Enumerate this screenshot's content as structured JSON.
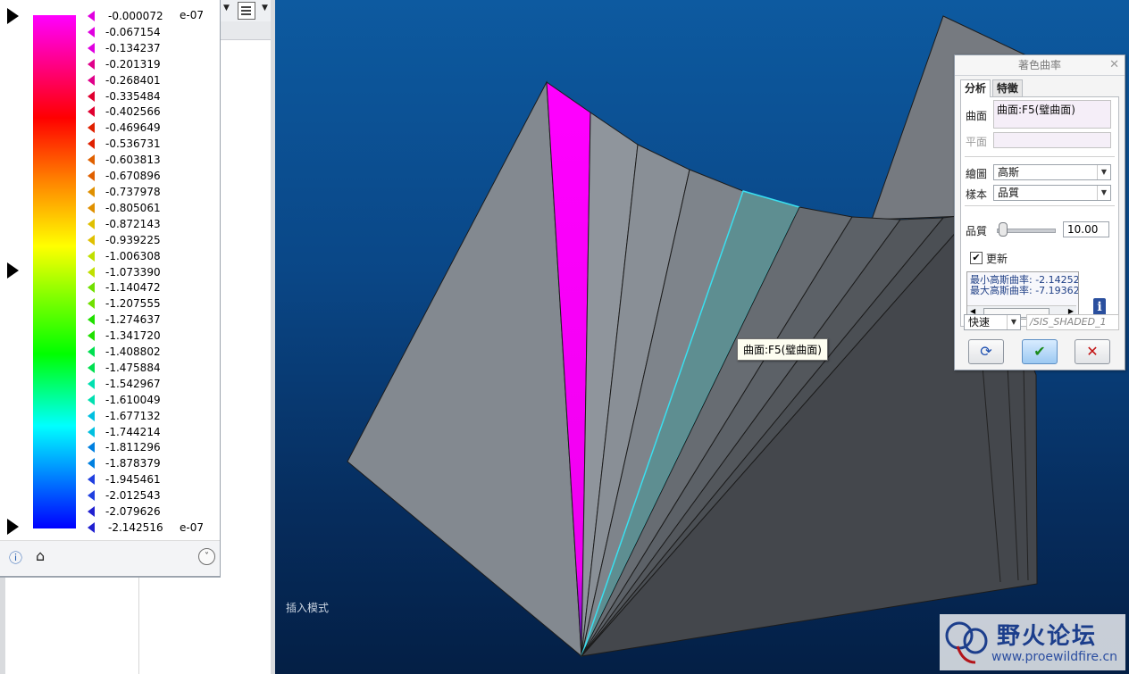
{
  "legend": {
    "values": [
      "-0.000072",
      "-0.067154",
      "-0.134237",
      "-0.201319",
      "-0.268401",
      "-0.335484",
      "-0.402566",
      "-0.469649",
      "-0.536731",
      "-0.603813",
      "-0.670896",
      "-0.737978",
      "-0.805061",
      "-0.872143",
      "-0.939225",
      "-1.006308",
      "-1.073390",
      "-1.140472",
      "-1.207555",
      "-1.274637",
      "-1.341720",
      "-1.408802",
      "-1.475884",
      "-1.542967",
      "-1.610049",
      "-1.677132",
      "-1.744214",
      "-1.811296",
      "-1.878379",
      "-1.945461",
      "-2.012543",
      "-2.079626",
      "-2.142516"
    ],
    "exponent_top": "e-07",
    "exponent_bottom": "e-07",
    "colors": [
      "#ff00ff",
      "#ff0000",
      "#ffff00",
      "#00ff00",
      "#00ffff",
      "#0000ff"
    ]
  },
  "viewport": {
    "mode_label": "插入模式",
    "tooltip": "曲面:F5(璧曲面)"
  },
  "dialog": {
    "title": "著色曲率",
    "tabs": [
      "分析",
      "特徵"
    ],
    "surface_label": "曲面",
    "surface_value": "曲面:F5(璧曲面)",
    "plane_label": "平面",
    "plot_label": "繪圖",
    "plot_value": "高斯",
    "sample_label": "樣本",
    "sample_value": "品質",
    "quality_label": "品質",
    "quality_value": "10.00",
    "update_label": "更新",
    "min_text": "最小高斯曲率: -2.14252",
    "max_text": "最大高斯曲率: -7.19362",
    "speed_value": "快速",
    "name_value": "/SIS_SHADED_1"
  },
  "watermark": {
    "name": "野火论坛",
    "url": "www.proewildfire.cn"
  }
}
